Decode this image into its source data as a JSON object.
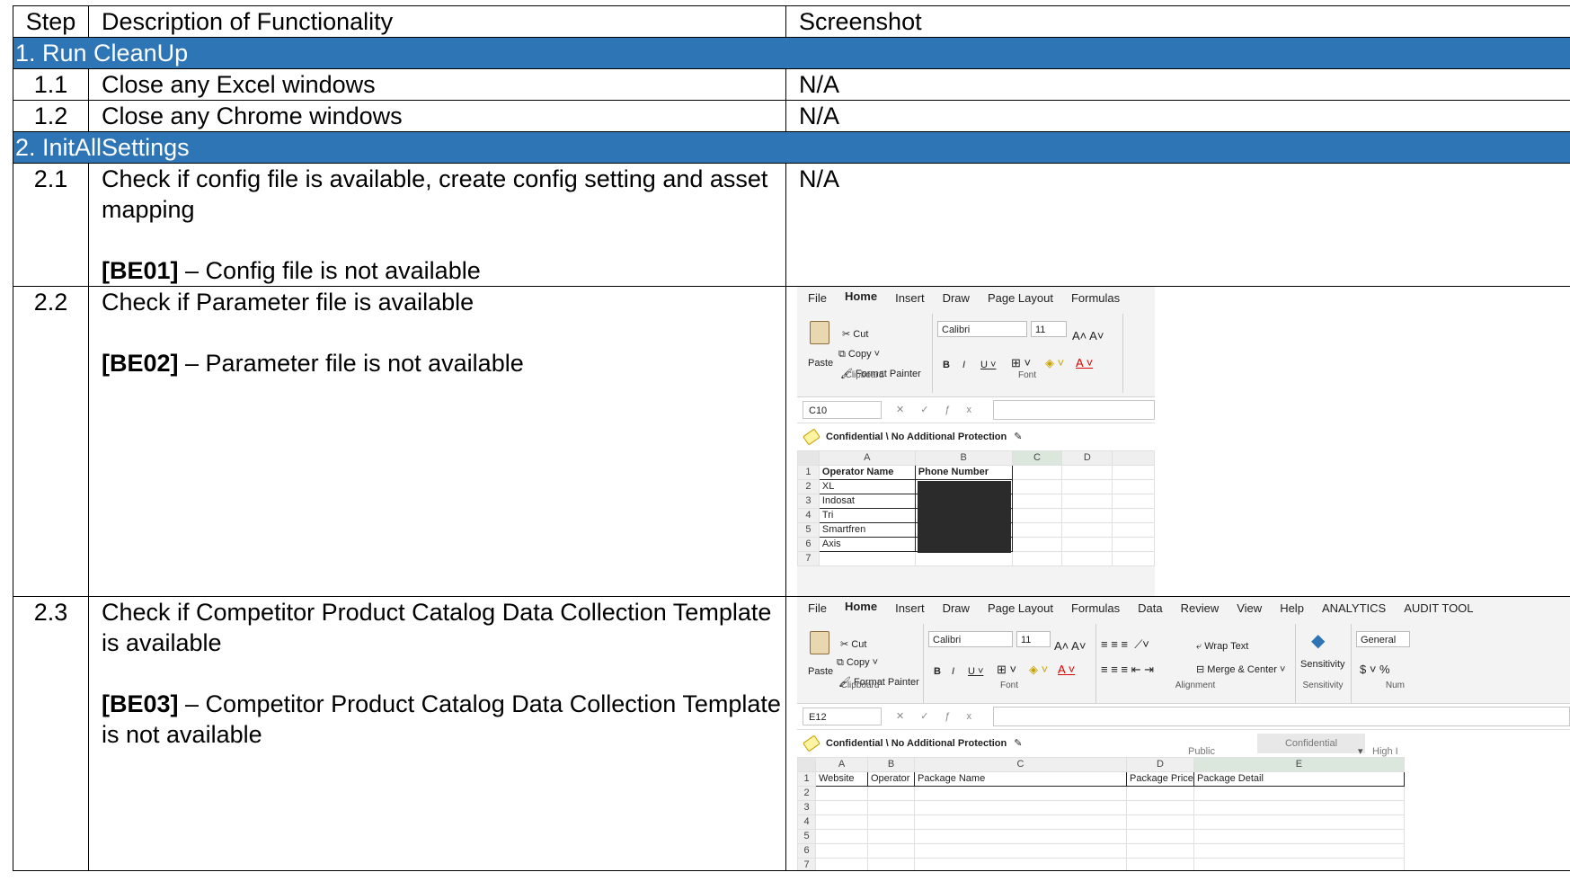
{
  "table": {
    "headers": {
      "step": "Step",
      "description": "Description of Functionality",
      "screenshot": "Screenshot"
    },
    "section1": {
      "title": "1.   Run CleanUp"
    },
    "row_1_1": {
      "step": "1.1",
      "description": "Close any Excel windows",
      "screenshot": "N/A"
    },
    "row_1_2": {
      "step": "1.2",
      "description": "Close any Chrome windows",
      "screenshot": "N/A"
    },
    "section2": {
      "title": "2.   InitAllSettings"
    },
    "row_2_1": {
      "step": "2.1",
      "description": "Check if config file is available, create config setting and asset mapping",
      "code": "[BE01]",
      "exception": " – Config file is not available",
      "screenshot": "N/A"
    },
    "row_2_2": {
      "step": "2.2",
      "description": "Check if Parameter file is available",
      "code": "[BE02]",
      "exception": " – Parameter file is not available"
    },
    "row_2_3": {
      "step": "2.3",
      "description": "Check if Competitor Product Catalog Data Collection Template is available",
      "code": "[BE03]",
      "exception": " – Competitor Product Catalog Data Collection Template is not available"
    }
  },
  "excel1": {
    "tabs": [
      "File",
      "Home",
      "Insert",
      "Draw",
      "Page Layout",
      "Formulas"
    ],
    "clipboard": {
      "cut": "Cut",
      "copy": "Copy",
      "format_painter": "Format Painter",
      "paste": "Paste",
      "label": "Clipboard"
    },
    "font": {
      "name": "Calibri",
      "size": "11",
      "label": "Font"
    },
    "name_box": "C10",
    "sensitivity": "Confidential \\ No Additional Protection",
    "columns": [
      "A",
      "B",
      "C",
      "D"
    ],
    "rows": [
      {
        "n": "1",
        "a": "Operator Name",
        "b": "Phone Number"
      },
      {
        "n": "2",
        "a": "XL",
        "b": ""
      },
      {
        "n": "3",
        "a": "Indosat",
        "b": ""
      },
      {
        "n": "4",
        "a": "Tri",
        "b": ""
      },
      {
        "n": "5",
        "a": "Smartfren",
        "b": ""
      },
      {
        "n": "6",
        "a": "Axis",
        "b": ""
      },
      {
        "n": "7",
        "a": "",
        "b": ""
      }
    ]
  },
  "excel2": {
    "tabs": [
      "File",
      "Home",
      "Insert",
      "Draw",
      "Page Layout",
      "Formulas",
      "Data",
      "Review",
      "View",
      "Help",
      "ANALYTICS",
      "AUDIT TOOL"
    ],
    "clipboard": {
      "cut": "Cut",
      "copy": "Copy",
      "format_painter": "Format Painter",
      "paste": "Paste",
      "label": "Clipboard"
    },
    "font": {
      "name": "Calibri",
      "size": "11",
      "label": "Font"
    },
    "alignment": {
      "wrap": "Wrap Text",
      "merge": "Merge & Center",
      "label": "Alignment"
    },
    "sensitivity_group": {
      "button": "Sensitivity",
      "label": "Sensitivity"
    },
    "number": {
      "format": "General",
      "label": "Num"
    },
    "name_box": "E12",
    "sensitivity": "Confidential \\ No Additional Protection",
    "label_public": "Public",
    "label_confidential": "Confidential",
    "label_high": "High I",
    "columns": [
      "A",
      "B",
      "C",
      "D",
      "E"
    ],
    "rows": [
      {
        "n": "1",
        "a": "Website",
        "b": "Operator",
        "c": "Package Name",
        "d": "Package Price",
        "e": "Package Detail"
      },
      {
        "n": "2"
      },
      {
        "n": "3"
      },
      {
        "n": "4"
      },
      {
        "n": "5"
      },
      {
        "n": "6"
      },
      {
        "n": "7"
      }
    ]
  }
}
